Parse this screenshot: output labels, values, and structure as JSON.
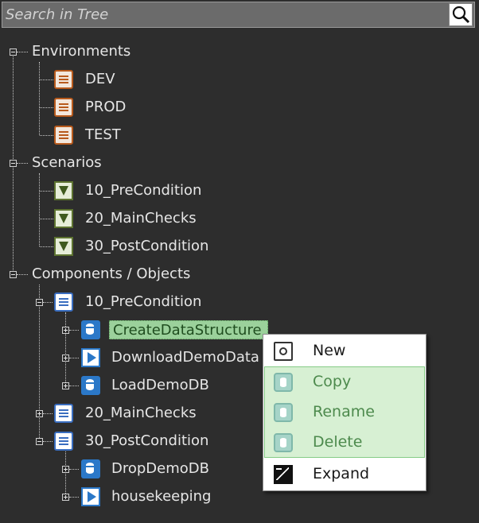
{
  "search": {
    "placeholder": "Search in Tree"
  },
  "tree": {
    "environments": {
      "label": "Environments",
      "items": [
        "DEV",
        "PROD",
        "TEST"
      ]
    },
    "scenarios": {
      "label": "Scenarios",
      "items": [
        "10_PreCondition",
        "20_MainChecks",
        "30_PostCondition"
      ]
    },
    "components": {
      "label": "Components / Objects",
      "groups": [
        {
          "label": "10_PreCondition",
          "children": [
            "CreateDataStructure",
            "DownloadDemoData",
            "LoadDemoDB"
          ]
        },
        {
          "label": "20_MainChecks"
        },
        {
          "label": "30_PostCondition",
          "children": [
            "DropDemoDB",
            "housekeeping"
          ]
        }
      ]
    }
  },
  "context_menu": {
    "items": [
      "New",
      "Copy",
      "Rename",
      "Delete",
      "Expand"
    ]
  },
  "colors": {
    "background": "#2d2d2d",
    "selected_bg": "#9bd19b",
    "menu_highlight": "#d7f0d3",
    "environment_icon": "#b85a1c",
    "scenario_icon": "#5d7330",
    "component_icon": "#2b78c8"
  }
}
